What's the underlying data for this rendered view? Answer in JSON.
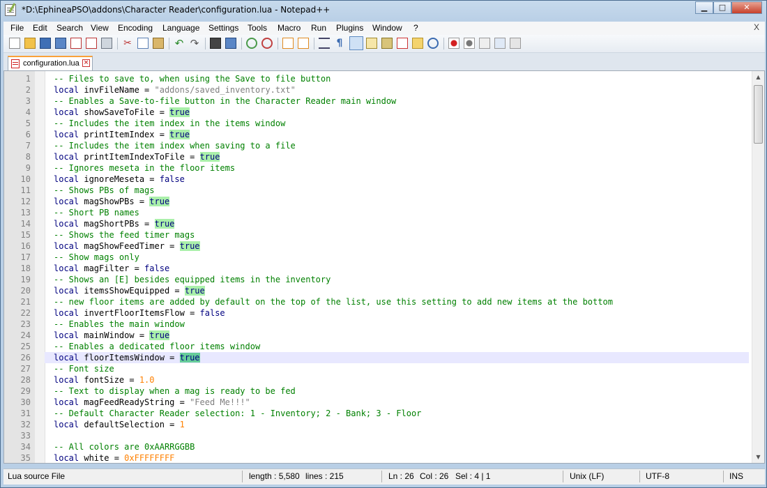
{
  "window": {
    "title": "*D:\\EphineaPSO\\addons\\Character Reader\\configuration.lua - Notepad++"
  },
  "menu": {
    "items": [
      "File",
      "Edit",
      "Search",
      "View",
      "Encoding",
      "Language",
      "Settings",
      "Tools",
      "Macro",
      "Run",
      "Plugins",
      "Window",
      "?"
    ],
    "close": "X"
  },
  "tab": {
    "label": "configuration.lua"
  },
  "editor": {
    "current_line": 26,
    "lines": [
      [
        [
          "c",
          "-- Files to save to, when using the Save to file button"
        ]
      ],
      [
        [
          "k",
          "local"
        ],
        [
          "i",
          " invFileName = "
        ],
        [
          "s",
          "\"addons/saved_inventory.txt\""
        ]
      ],
      [
        [
          "c",
          "-- Enables a Save-to-file button in the Character Reader main window"
        ]
      ],
      [
        [
          "k",
          "local"
        ],
        [
          "i",
          " showSaveToFile = "
        ],
        [
          "b",
          "true"
        ]
      ],
      [
        [
          "c",
          "-- Includes the item index in the items window"
        ]
      ],
      [
        [
          "k",
          "local"
        ],
        [
          "i",
          " printItemIndex = "
        ],
        [
          "b",
          "true"
        ]
      ],
      [
        [
          "c",
          "-- Includes the item index when saving to a file"
        ]
      ],
      [
        [
          "k",
          "local"
        ],
        [
          "i",
          " printItemIndexToFile = "
        ],
        [
          "b",
          "true"
        ]
      ],
      [
        [
          "c",
          "-- Ignores meseta in the floor items"
        ]
      ],
      [
        [
          "k",
          "local"
        ],
        [
          "i",
          " ignoreMeseta = "
        ],
        [
          "k",
          "false"
        ]
      ],
      [
        [
          "c",
          "-- Shows PBs of mags"
        ]
      ],
      [
        [
          "k",
          "local"
        ],
        [
          "i",
          " magShowPBs = "
        ],
        [
          "b",
          "true"
        ]
      ],
      [
        [
          "c",
          "-- Short PB names"
        ]
      ],
      [
        [
          "k",
          "local"
        ],
        [
          "i",
          " magShortPBs = "
        ],
        [
          "b",
          "true"
        ]
      ],
      [
        [
          "c",
          "-- Shows the feed timer mags"
        ]
      ],
      [
        [
          "k",
          "local"
        ],
        [
          "i",
          " magShowFeedTimer = "
        ],
        [
          "b",
          "true"
        ]
      ],
      [
        [
          "c",
          "-- Show mags only"
        ]
      ],
      [
        [
          "k",
          "local"
        ],
        [
          "i",
          " magFilter = "
        ],
        [
          "k",
          "false"
        ]
      ],
      [
        [
          "c",
          "-- Shows an [E] besides equipped items in the inventory"
        ]
      ],
      [
        [
          "k",
          "local"
        ],
        [
          "i",
          " itemsShowEquipped = "
        ],
        [
          "b",
          "true"
        ]
      ],
      [
        [
          "c",
          "-- new floor items are added by default on the top of the list, use this setting to add new items at the bottom"
        ]
      ],
      [
        [
          "k",
          "local"
        ],
        [
          "i",
          " invertFloorItemsFlow = "
        ],
        [
          "k",
          "false"
        ]
      ],
      [
        [
          "c",
          "-- Enables the main window"
        ]
      ],
      [
        [
          "k",
          "local"
        ],
        [
          "i",
          " mainWindow = "
        ],
        [
          "b",
          "true"
        ]
      ],
      [
        [
          "c",
          "-- Enables a dedicated floor items window"
        ]
      ],
      [
        [
          "k",
          "local"
        ],
        [
          "i",
          " floorItemsWindow = "
        ],
        [
          "B",
          "true"
        ]
      ],
      [
        [
          "c",
          "-- Font size"
        ]
      ],
      [
        [
          "k",
          "local"
        ],
        [
          "i",
          " fontSize = "
        ],
        [
          "n",
          "1.0"
        ]
      ],
      [
        [
          "c",
          "-- Text to display when a mag is ready to be fed"
        ]
      ],
      [
        [
          "k",
          "local"
        ],
        [
          "i",
          " magFeedReadyString = "
        ],
        [
          "s",
          "\"Feed Me!!!\""
        ]
      ],
      [
        [
          "c",
          "-- Default Character Reader selection: 1 - Inventory; 2 - Bank; 3 - Floor"
        ]
      ],
      [
        [
          "k",
          "local"
        ],
        [
          "i",
          " defaultSelection = "
        ],
        [
          "n",
          "1"
        ]
      ],
      [],
      [
        [
          "c",
          "-- All colors are 0xAARRGGBB"
        ]
      ],
      [
        [
          "k",
          "local"
        ],
        [
          "i",
          " white = "
        ],
        [
          "n",
          "0xFFFFFFFF"
        ]
      ]
    ]
  },
  "status": {
    "file_type": "Lua source File",
    "length": "length : 5,580",
    "lines": "lines : 215",
    "ln": "Ln : 26",
    "col": "Col : 26",
    "sel": "Sel : 4 | 1",
    "eol": "Unix (LF)",
    "encoding": "UTF-8",
    "mode": "INS"
  }
}
